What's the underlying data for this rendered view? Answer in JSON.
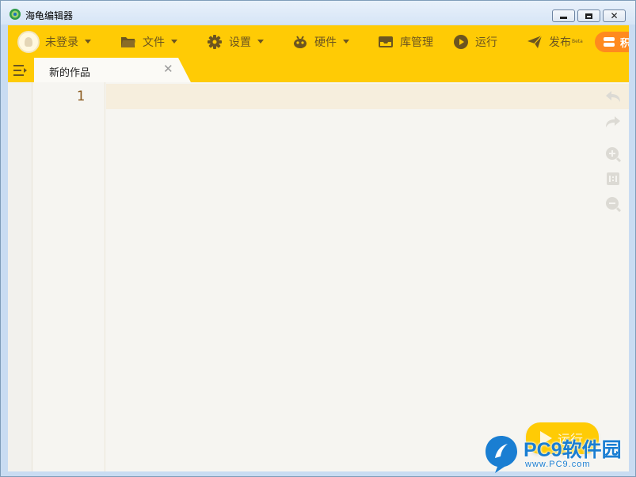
{
  "window": {
    "title": "海龟编辑器"
  },
  "toolbar": {
    "user_label": "未登录",
    "file_label": "文件",
    "settings_label": "设置",
    "hardware_label": "硬件",
    "library_label": "库管理",
    "run_label": "运行",
    "publish_label": "发布",
    "publish_badge": "Beta",
    "extra_label": "积"
  },
  "tabs": [
    {
      "label": "新的作品",
      "active": true
    }
  ],
  "editor": {
    "line_numbers": [
      "1"
    ],
    "content": ""
  },
  "side_tools": [
    "undo-icon",
    "redo-icon",
    "zoom-in-icon",
    "zoom-reset-icon",
    "zoom-out-icon"
  ],
  "run_button": {
    "label": "运行"
  },
  "watermark": {
    "text": "PC9软件园",
    "url": "www.PC9.com"
  },
  "colors": {
    "accent": "#ffcb05",
    "toolbar_text": "#6c5520",
    "editor_bg": "#f6f5f1",
    "active_line": "#f6eedd",
    "line_number": "#8a5a1e"
  }
}
